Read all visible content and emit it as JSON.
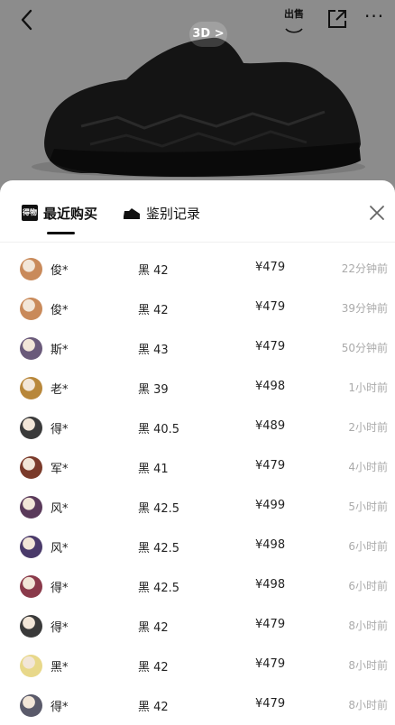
{
  "header": {
    "badge_3d": "3D >",
    "sell_label": "出售",
    "more_label": "···"
  },
  "tabs": {
    "recent_logo": "得物",
    "recent_label": "最近购买",
    "auth_label": "鉴别记录"
  },
  "icons": {
    "back": "chevron-left-icon",
    "sell": "sell-icon",
    "share": "share-icon",
    "more": "more-icon",
    "shoe": "sneaker-icon",
    "close": "close-icon"
  },
  "colors": {
    "accent": "#111111",
    "muted_time": "#aaaaaa",
    "overlay": "#8a8a8a"
  },
  "purchases": [
    {
      "user": "俊*",
      "size": "黑 42",
      "price": "¥479",
      "time": "22分钟前",
      "avatar": "#c98a5a"
    },
    {
      "user": "俊*",
      "size": "黑 42",
      "price": "¥479",
      "time": "39分钟前",
      "avatar": "#c98a5a"
    },
    {
      "user": "斯*",
      "size": "黑 43",
      "price": "¥479",
      "time": "50分钟前",
      "avatar": "#6a5a7a"
    },
    {
      "user": "老*",
      "size": "黑 39",
      "price": "¥498",
      "time": "1小时前",
      "avatar": "#b8873a"
    },
    {
      "user": "得*",
      "size": "黑 40.5",
      "price": "¥489",
      "time": "2小时前",
      "avatar": "#3a3a3a"
    },
    {
      "user": "军*",
      "size": "黑 41",
      "price": "¥479",
      "time": "4小时前",
      "avatar": "#7a3a2a"
    },
    {
      "user": "风*",
      "size": "黑 42.5",
      "price": "¥499",
      "time": "5小时前",
      "avatar": "#5a3a5a"
    },
    {
      "user": "风*",
      "size": "黑 42.5",
      "price": "¥498",
      "time": "6小时前",
      "avatar": "#4a3a6a"
    },
    {
      "user": "得*",
      "size": "黑 42.5",
      "price": "¥498",
      "time": "6小时前",
      "avatar": "#8a3a4a"
    },
    {
      "user": "得*",
      "size": "黑 42",
      "price": "¥479",
      "time": "8小时前",
      "avatar": "#3a3a3a"
    },
    {
      "user": "黑*",
      "size": "黑 42",
      "price": "¥479",
      "time": "8小时前",
      "avatar": "#e8d88a"
    },
    {
      "user": "得*",
      "size": "黑 42",
      "price": "¥479",
      "time": "8小时前",
      "avatar": "#5a5a6a"
    }
  ]
}
